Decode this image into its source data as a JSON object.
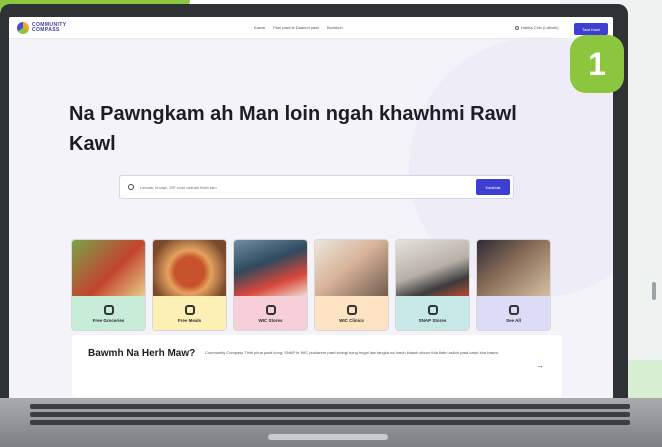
{
  "page": {
    "step_badge": "1"
  },
  "nav": {
    "logo_line1": "COMMUNITY",
    "logo_line2": "COMPASS",
    "links": [
      "Kawm",
      "Pian pawl le Daanmi pawl",
      "Bochhuh"
    ],
    "language": "Hakha Chin (Laiholh)",
    "button_label": "Tawl Kawl"
  },
  "hero": {
    "title": "Na Pawngkam ah Man loin ngah khawhmi Rawl Kawl"
  },
  "search": {
    "placeholder": "Lahnak, khuapi, ZIP code asiloah thlah tam",
    "button_label": "Kawlnak"
  },
  "categories": [
    {
      "label": "Free Groceries",
      "icon": "cart-icon",
      "color": "#c7ecd8"
    },
    {
      "label": "Free Meals",
      "icon": "utensils-icon",
      "color": "#fdf0b5"
    },
    {
      "label": "WIC Stores",
      "icon": "store-icon",
      "color": "#f7cfd8"
    },
    {
      "label": "WIC Clinics",
      "icon": "clinic-icon",
      "color": "#fde3c2"
    },
    {
      "label": "SNAP Stores",
      "icon": "snap-icon",
      "color": "#c7e9e7"
    },
    {
      "label": "See All",
      "icon": "grid-icon",
      "color": "#dcdcf6"
    }
  ],
  "info": {
    "title": "Bawmh Na Herh Maw?",
    "text": "Community Compass Thilri phun pawl kong, SNAP le WIC prokarem pawl siningi kong hngal law tangka na hmuh khawh ahcun thla fiatin asiloh pawl cawk kha bawm.",
    "arrow": "→"
  },
  "colors": {
    "accent": "#3c3fd1",
    "brand_green": "#8cc63f"
  }
}
